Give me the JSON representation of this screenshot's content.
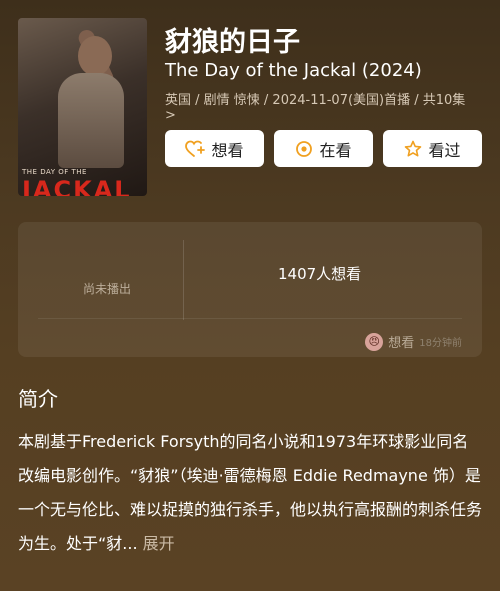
{
  "header": {
    "title_cn": "豺狼的日子",
    "title_en": "The Day of the Jackal (2024)",
    "meta": "英国 / 剧情 惊悚 / 2024-11-07(美国)首播 / 共10集",
    "meta_chevron": ">"
  },
  "poster": {
    "small_text": "THE DAY OF THE",
    "big_text": "JACKAL"
  },
  "actions": {
    "want_label": "想看",
    "watching_label": "在看",
    "watched_label": "看过"
  },
  "stats": {
    "status": "尚未播出",
    "want_count": "1407人想看",
    "activity_label": "想看",
    "activity_time": "18分钟前",
    "avatar_glyph": "😠"
  },
  "synopsis": {
    "heading": "简介",
    "text": "本剧基于Frederick Forsyth的同名小说和1973年环球影业同名改编电影创作。“豺狼”（埃迪·雷德梅恩 Eddie Redmayne 饰）是一个无与伦比、难以捉摸的独行杀手，他以执行高报酬的刺杀任务为生。处于“豺...",
    "expand_label": "展开"
  },
  "icons": {
    "want": "heart-plus-icon",
    "watching": "target-icon",
    "watched": "star-icon"
  },
  "colors": {
    "accent_orange": "#f0a020",
    "background": "#4a3820"
  }
}
